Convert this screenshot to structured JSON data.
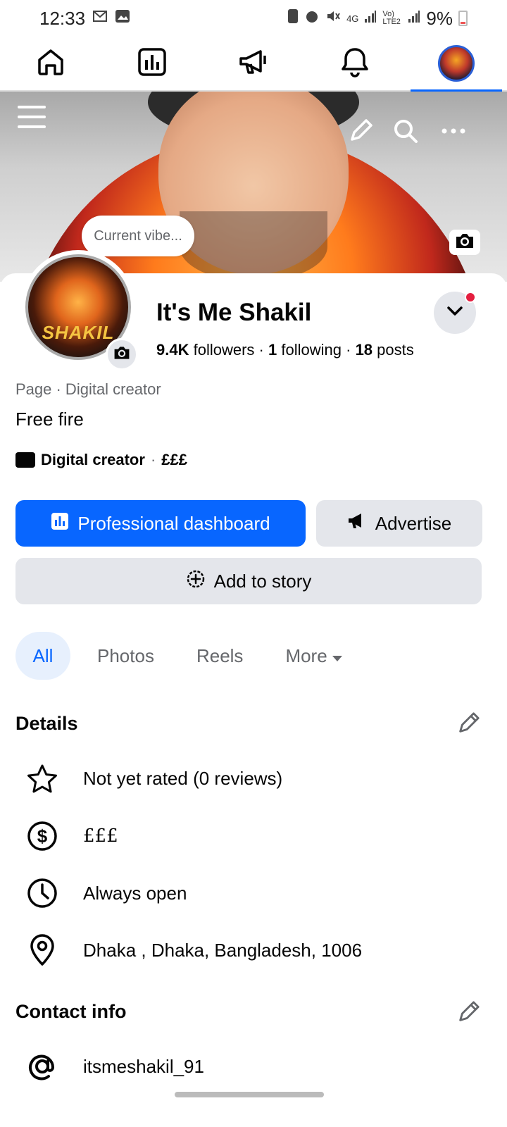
{
  "status_bar": {
    "time": "12:33",
    "battery": "9%",
    "network": "4G",
    "volte": "Vo) LTE2"
  },
  "top_nav": {
    "items": [
      {
        "icon": "home-icon"
      },
      {
        "icon": "dashboard-icon"
      },
      {
        "icon": "megaphone-icon"
      },
      {
        "icon": "bell-icon"
      },
      {
        "icon": "profile-avatar",
        "active": true
      }
    ]
  },
  "cover": {
    "vibe_prompt": "Current vibe..."
  },
  "profile": {
    "name": "It's Me Shakil",
    "avatar_text": "SHAKIL",
    "followers_count": "9.4K",
    "followers_label": "followers",
    "following_count": "1",
    "following_label": "following",
    "posts_count": "18",
    "posts_label": "posts",
    "category": "Page · Digital creator",
    "bio": "Free fire",
    "creator_label": "Digital creator",
    "creator_price": "£££"
  },
  "actions": {
    "dashboard_label": "Professional dashboard",
    "advertise_label": "Advertise",
    "story_label": "Add to story"
  },
  "tabs": [
    {
      "label": "All",
      "active": true
    },
    {
      "label": "Photos"
    },
    {
      "label": "Reels"
    },
    {
      "label": "More"
    }
  ],
  "details": {
    "title": "Details",
    "rating": "Not yet rated (0 reviews)",
    "price": "£££",
    "hours": "Always open",
    "address": "Dhaka , Dhaka, Bangladesh, 1006"
  },
  "contact": {
    "title": "Contact info",
    "username": "itsmeshakil_91"
  },
  "colors": {
    "accent": "#0866ff",
    "secondary_bg": "#e4e6eb",
    "muted_text": "#65676b",
    "notification": "#e41e3f"
  }
}
